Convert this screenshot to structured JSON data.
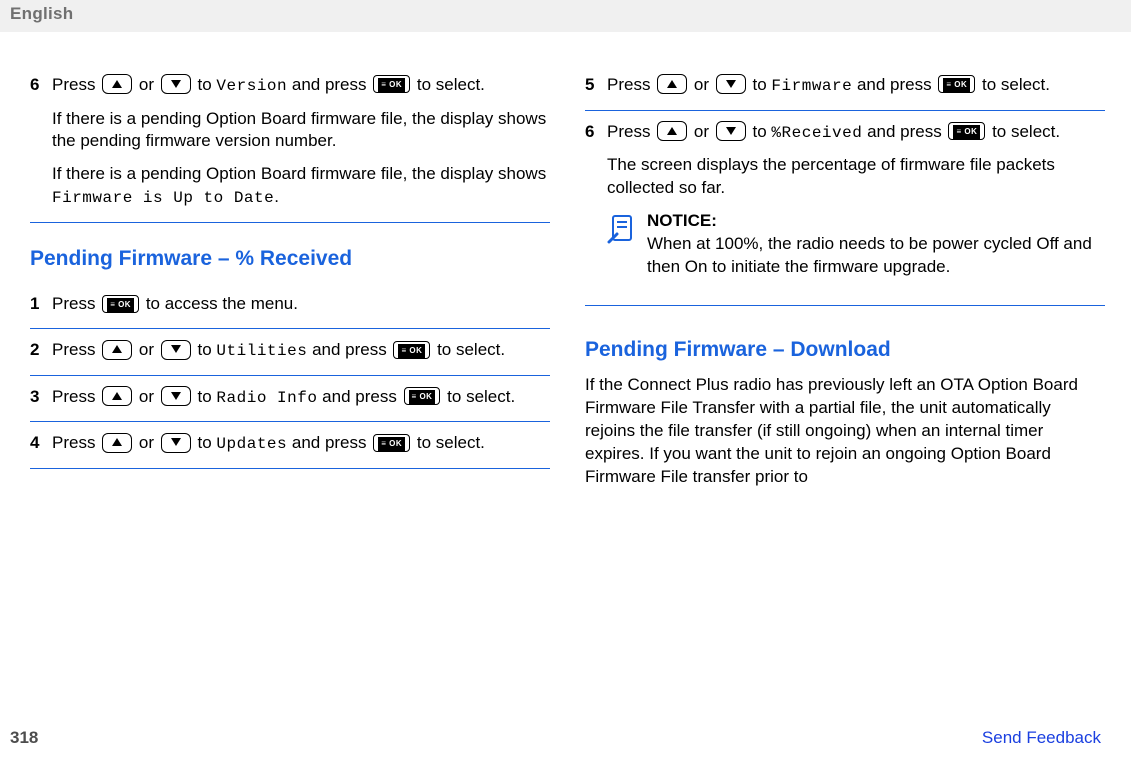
{
  "header": {
    "lang": "English"
  },
  "left": {
    "step6": {
      "num": "6",
      "p1_a": "Press ",
      "p1_or": " or ",
      "p1_to": " to ",
      "p1_target": "Version",
      "p1_andpress": " and press ",
      "p1_end": " to select.",
      "p2": "If there is a pending Option Board firmware file, the display shows the pending firmware version number.",
      "p3_a": "If there is a pending Option Board firmware file, the display shows ",
      "p3_b": "Firmware is Up to Date",
      "p3_c": "."
    },
    "headingA": "Pending Firmware – % Received",
    "step1": {
      "num": "1",
      "a": "Press ",
      "b": " to access the menu."
    },
    "step2": {
      "num": "2",
      "a": "Press ",
      "or": " or ",
      "to": " to ",
      "target": "Utilities",
      "andpress": " and press ",
      "end": " to select."
    },
    "step3": {
      "num": "3",
      "a": "Press ",
      "or": " or ",
      "to": " to ",
      "target": "Radio Info",
      "andpress": " and press ",
      "end": " to select."
    },
    "step4": {
      "num": "4",
      "a": "Press ",
      "or": " or ",
      "to": " to ",
      "target": "Updates",
      "andpress": " and press ",
      "end": " to select."
    }
  },
  "right": {
    "step5": {
      "num": "5",
      "a": "Press ",
      "or": " or ",
      "to": " to ",
      "target": "Firmware",
      "andpress": " and press ",
      "end": " to select."
    },
    "step6": {
      "num": "6",
      "a": "Press ",
      "or": " or ",
      "to": " to ",
      "target": "%Received",
      "andpress": " and press ",
      "end": " to select.",
      "p2": "The screen displays the percentage of firmware file packets collected so far.",
      "noticeTitle": "NOTICE:",
      "noticeBody": "When at 100%, the radio needs to be power cycled Off and then On to initiate the firmware upgrade."
    },
    "headingB": "Pending Firmware – Download",
    "paraB": "If the Connect Plus radio has previously left an OTA Option Board Firmware File Transfer with a partial file, the unit automatically rejoins the file transfer (if still ongoing) when an internal timer expires. If you want the unit to rejoin an ongoing Option Board Firmware File transfer prior to"
  },
  "footer": {
    "page": "318",
    "feedback": "Send Feedback"
  },
  "icons": {
    "ok": "OK"
  }
}
